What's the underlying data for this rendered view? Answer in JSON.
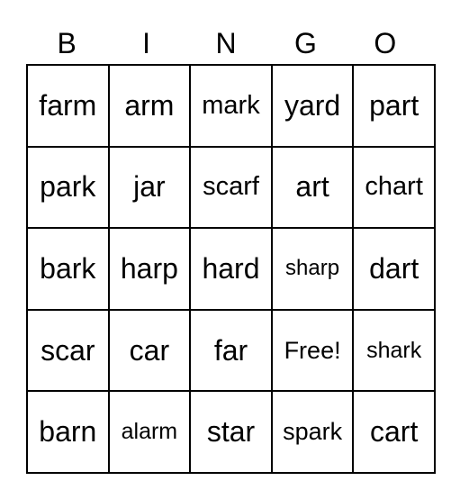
{
  "header": [
    "B",
    "I",
    "N",
    "G",
    "O"
  ],
  "cells": [
    [
      "farm",
      "arm",
      "mark",
      "yard",
      "part"
    ],
    [
      "park",
      "jar",
      "scarf",
      "art",
      "chart"
    ],
    [
      "bark",
      "harp",
      "hard",
      "sharp",
      "dart"
    ],
    [
      "scar",
      "car",
      "far",
      "Free!",
      "shark"
    ],
    [
      "barn",
      "alarm",
      "star",
      "spark",
      "cart"
    ]
  ]
}
